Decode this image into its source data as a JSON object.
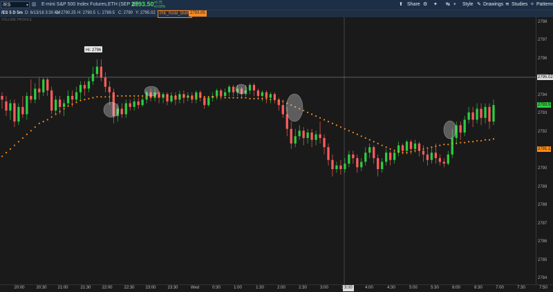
{
  "toolbar": {
    "symbol": "/ES",
    "description": "E-mini S&P 500 Index Futures,ETH (SEP 18)",
    "last_price": "2793.50",
    "change_top": "+0.75",
    "change_bottom": "+0.03%",
    "share_label": "Share",
    "style_label": "Style",
    "drawings_label": "Drawings",
    "studies_label": "Studies",
    "patterns_label": "Patterns"
  },
  "info": {
    "ticker": "/ES 5 D 5m",
    "date": "D: 6/13/18 3:30 AM",
    "open": "O: 2790.25",
    "high": "H: 2790.5",
    "low": "L: 2789.5",
    "close": "C: 2790",
    "y": "Y: 2795.02",
    "study_name": "PIK_RAM_5MIN",
    "study_value": "2793.05",
    "sub_label": "VOLUME PROFILE"
  },
  "annotations": {
    "hi_label": "Hi: 2796"
  },
  "price_tags": {
    "crosshair": "2795.02",
    "last": "2793.5",
    "ma": "2791.1"
  },
  "cursor_time": "3:30",
  "colors": {
    "up": "#2ecc40",
    "down": "#ff5c5c",
    "ma": "#ff8c1a",
    "bg": "#1a1a1a"
  },
  "yaxis": {
    "ticks": [
      "2798",
      "2797",
      "2796",
      "2795",
      "2794",
      "2793",
      "2792",
      "2791",
      "2790",
      "2789",
      "2788",
      "2787",
      "2786",
      "2785",
      "2784"
    ]
  },
  "xaxis": {
    "ticks": [
      "20:00",
      "20:30",
      "21:00",
      "21:30",
      "22:00",
      "22:30",
      "23:00",
      "23:30",
      "Wed",
      "0:30",
      "1:00",
      "1:30",
      "2:00",
      "2:30",
      "3:00",
      "3:30",
      "4:00",
      "4:30",
      "5:00",
      "5:30",
      "6:00",
      "6:30",
      "7:00",
      "7:30",
      "7:50"
    ]
  },
  "chart_data": {
    "type": "candlestick",
    "ylim": [
      2783.7,
      2798.3
    ],
    "candles": [
      [
        2794.0,
        2793.8,
        2794.2,
        2793.3
      ],
      [
        2793.7,
        2793.2,
        2794.0,
        2792.9
      ],
      [
        2793.2,
        2793.6,
        2793.8,
        2792.7
      ],
      [
        2793.6,
        2792.6,
        2793.8,
        2792.3
      ],
      [
        2792.6,
        2793.4,
        2793.6,
        2792.4
      ],
      [
        2793.4,
        2793.0,
        2794.0,
        2792.8
      ],
      [
        2793.0,
        2794.0,
        2794.2,
        2792.7
      ],
      [
        2794.0,
        2793.8,
        2794.9,
        2793.6
      ],
      [
        2793.8,
        2794.4,
        2794.7,
        2793.6
      ],
      [
        2794.4,
        2794.2,
        2795.0,
        2793.8
      ],
      [
        2794.2,
        2794.9,
        2795.0,
        2794.0
      ],
      [
        2794.9,
        2794.3,
        2795.0,
        2794.0
      ],
      [
        2794.3,
        2793.2,
        2794.5,
        2793.0
      ],
      [
        2793.2,
        2793.8,
        2794.0,
        2793.0
      ],
      [
        2793.8,
        2793.4,
        2794.0,
        2793.0
      ],
      [
        2793.4,
        2793.6,
        2793.8,
        2792.9
      ],
      [
        2793.6,
        2794.0,
        2794.3,
        2793.4
      ],
      [
        2794.0,
        2793.8,
        2794.3,
        2793.4
      ],
      [
        2793.8,
        2794.2,
        2794.5,
        2793.6
      ],
      [
        2794.2,
        2794.6,
        2794.8,
        2793.8
      ],
      [
        2794.6,
        2794.4,
        2794.8,
        2794.0
      ],
      [
        2794.4,
        2794.8,
        2795.0,
        2794.2
      ],
      [
        2794.8,
        2795.2,
        2795.6,
        2794.6
      ],
      [
        2795.2,
        2795.6,
        2796.0,
        2795.0
      ],
      [
        2795.6,
        2795.0,
        2796.0,
        2794.8
      ],
      [
        2795.0,
        2794.5,
        2795.3,
        2794.2
      ],
      [
        2794.5,
        2794.2,
        2794.8,
        2793.5
      ],
      [
        2794.2,
        2792.9,
        2794.4,
        2792.5
      ],
      [
        2792.9,
        2793.3,
        2793.6,
        2792.6
      ],
      [
        2793.3,
        2793.0,
        2793.6,
        2792.8
      ],
      [
        2793.0,
        2793.6,
        2793.8,
        2792.8
      ],
      [
        2793.6,
        2793.4,
        2793.8,
        2793.2
      ],
      [
        2793.4,
        2793.7,
        2793.9,
        2793.2
      ],
      [
        2793.7,
        2793.5,
        2793.9,
        2793.3
      ],
      [
        2793.5,
        2793.8,
        2794.0,
        2793.4
      ],
      [
        2793.8,
        2794.2,
        2794.3,
        2793.6
      ],
      [
        2794.2,
        2793.9,
        2794.4,
        2793.7
      ],
      [
        2793.9,
        2794.2,
        2794.4,
        2793.7
      ],
      [
        2794.2,
        2793.9,
        2794.3,
        2793.6
      ],
      [
        2793.9,
        2794.1,
        2794.2,
        2793.6
      ],
      [
        2794.1,
        2793.7,
        2794.2,
        2793.5
      ],
      [
        2793.7,
        2794.0,
        2794.2,
        2793.6
      ],
      [
        2794.0,
        2793.8,
        2794.2,
        2793.5
      ],
      [
        2793.8,
        2794.1,
        2794.3,
        2793.6
      ],
      [
        2794.1,
        2793.9,
        2794.3,
        2793.6
      ],
      [
        2793.9,
        2794.0,
        2794.2,
        2793.7
      ],
      [
        2794.0,
        2793.8,
        2794.2,
        2793.6
      ],
      [
        2793.8,
        2794.2,
        2794.3,
        2793.6
      ],
      [
        2794.2,
        2793.9,
        2794.3,
        2793.7
      ],
      [
        2793.9,
        2793.5,
        2794.0,
        2793.3
      ],
      [
        2793.5,
        2793.9,
        2794.0,
        2793.4
      ],
      [
        2793.9,
        2794.0,
        2794.2,
        2793.7
      ],
      [
        2794.0,
        2794.3,
        2794.4,
        2793.8
      ],
      [
        2794.3,
        2794.0,
        2794.4,
        2793.8
      ],
      [
        2794.0,
        2794.2,
        2794.4,
        2793.9
      ],
      [
        2794.2,
        2794.5,
        2794.6,
        2794.0
      ],
      [
        2794.5,
        2794.2,
        2794.6,
        2794.0
      ],
      [
        2794.2,
        2794.4,
        2794.6,
        2794.0
      ],
      [
        2794.4,
        2794.1,
        2794.5,
        2793.9
      ],
      [
        2794.1,
        2794.3,
        2794.6,
        2794.0
      ],
      [
        2794.3,
        2794.6,
        2794.7,
        2794.1
      ],
      [
        2794.6,
        2794.3,
        2794.7,
        2794.0
      ],
      [
        2794.3,
        2794.0,
        2794.4,
        2793.8
      ],
      [
        2794.0,
        2794.2,
        2794.3,
        2793.7
      ],
      [
        2794.2,
        2793.9,
        2794.3,
        2793.6
      ],
      [
        2793.9,
        2794.1,
        2794.2,
        2793.6
      ],
      [
        2794.1,
        2793.8,
        2794.2,
        2793.6
      ],
      [
        2793.8,
        2793.5,
        2793.9,
        2793.2
      ],
      [
        2793.5,
        2793.0,
        2793.8,
        2792.8
      ],
      [
        2793.0,
        2792.2,
        2793.4,
        2791.8
      ],
      [
        2792.2,
        2791.4,
        2792.6,
        2791.1
      ],
      [
        2791.4,
        2791.8,
        2792.2,
        2791.2
      ],
      [
        2791.8,
        2792.1,
        2792.4,
        2791.6
      ],
      [
        2792.1,
        2791.7,
        2792.3,
        2791.3
      ],
      [
        2791.7,
        2792.0,
        2792.2,
        2791.4
      ],
      [
        2792.0,
        2791.6,
        2792.2,
        2791.2
      ],
      [
        2791.6,
        2791.9,
        2792.1,
        2791.3
      ],
      [
        2791.9,
        2791.7,
        2792.6,
        2791.4
      ],
      [
        2791.7,
        2791.2,
        2791.9,
        2790.8
      ],
      [
        2791.2,
        2790.5,
        2791.4,
        2790.2
      ],
      [
        2790.5,
        2790.0,
        2790.8,
        2789.6
      ],
      [
        2790.0,
        2790.2,
        2790.4,
        2789.8
      ],
      [
        2790.2,
        2790.0,
        2790.5,
        2789.7
      ],
      [
        2790.0,
        2790.3,
        2790.6,
        2789.8
      ],
      [
        2790.3,
        2790.8,
        2791.0,
        2790.1
      ],
      [
        2790.8,
        2790.6,
        2791.0,
        2790.3
      ],
      [
        2790.6,
        2790.1,
        2790.8,
        2789.8
      ],
      [
        2790.1,
        2790.4,
        2790.6,
        2789.9
      ],
      [
        2790.4,
        2790.9,
        2791.2,
        2790.2
      ],
      [
        2790.9,
        2791.2,
        2791.4,
        2790.6
      ],
      [
        2791.2,
        2790.6,
        2791.3,
        2790.3
      ],
      [
        2790.6,
        2790.0,
        2790.8,
        2789.6
      ],
      [
        2790.0,
        2790.4,
        2790.6,
        2789.8
      ],
      [
        2790.4,
        2790.9,
        2791.1,
        2790.2
      ],
      [
        2790.9,
        2790.5,
        2791.0,
        2790.2
      ],
      [
        2790.5,
        2790.9,
        2791.1,
        2790.3
      ],
      [
        2790.9,
        2791.3,
        2791.5,
        2790.7
      ],
      [
        2791.3,
        2791.0,
        2791.4,
        2790.8
      ],
      [
        2791.0,
        2791.5,
        2791.6,
        2790.8
      ],
      [
        2791.5,
        2791.1,
        2791.6,
        2790.8
      ],
      [
        2791.1,
        2791.4,
        2791.6,
        2790.9
      ],
      [
        2791.4,
        2791.0,
        2791.5,
        2790.7
      ],
      [
        2791.0,
        2790.8,
        2791.3,
        2790.4
      ],
      [
        2790.8,
        2790.5,
        2791.1,
        2790.2
      ],
      [
        2790.5,
        2790.9,
        2791.2,
        2790.3
      ],
      [
        2790.9,
        2790.6,
        2791.4,
        2790.3
      ],
      [
        2790.6,
        2790.4,
        2790.8,
        2790.2
      ],
      [
        2790.4,
        2790.3,
        2790.6,
        2790.1
      ],
      [
        2790.3,
        2790.8,
        2791.0,
        2790.2
      ],
      [
        2790.8,
        2791.7,
        2792.2,
        2790.6
      ],
      [
        2791.7,
        2792.4,
        2792.6,
        2791.4
      ],
      [
        2792.4,
        2792.0,
        2792.6,
        2791.6
      ],
      [
        2792.0,
        2792.7,
        2792.9,
        2791.8
      ],
      [
        2792.7,
        2793.1,
        2793.4,
        2792.5
      ],
      [
        2793.1,
        2792.7,
        2793.4,
        2792.3
      ],
      [
        2792.7,
        2793.3,
        2793.6,
        2792.5
      ],
      [
        2793.3,
        2792.8,
        2793.6,
        2792.4
      ],
      [
        2792.8,
        2793.4,
        2793.6,
        2792.5
      ],
      [
        2793.4,
        2792.6,
        2793.6,
        2792.2
      ],
      [
        2792.6,
        2793.5,
        2793.8,
        2792.4
      ]
    ],
    "ma": [
      2790.7,
      2790.9,
      2791.1,
      2791.3,
      2791.5,
      2791.7,
      2791.9,
      2792.1,
      2792.3,
      2792.5,
      2792.6,
      2792.7,
      2792.85,
      2793.0,
      2793.15,
      2793.3,
      2793.45,
      2793.55,
      2793.65,
      2793.75,
      2793.8,
      2793.85,
      2793.9,
      2793.95,
      2793.95,
      2793.95,
      2793.95,
      2794.0,
      2794.0,
      2794.0,
      2794.0,
      2794.0,
      2794.0,
      2794.0,
      2794.0,
      2794.0,
      2794.0,
      2794.0,
      2794.0,
      2794.0,
      2794.0,
      2794.0,
      2794.0,
      2794.0,
      2794.0,
      2794.0,
      2794.0,
      2794.0,
      2793.95,
      2793.95,
      2793.95,
      2793.95,
      2793.95,
      2793.95,
      2793.9,
      2793.9,
      2793.9,
      2793.9,
      2793.9,
      2793.9,
      2793.85,
      2793.85,
      2793.85,
      2793.85,
      2793.85,
      2793.8,
      2793.8,
      2793.75,
      2793.7,
      2793.6,
      2793.5,
      2793.4,
      2793.3,
      2793.2,
      2793.1,
      2793.0,
      2792.9,
      2792.8,
      2792.7,
      2792.6,
      2792.5,
      2792.4,
      2792.3,
      2792.2,
      2792.1,
      2792.0,
      2791.9,
      2791.8,
      2791.7,
      2791.6,
      2791.5,
      2791.4,
      2791.3,
      2791.2,
      2791.1,
      2791.0,
      2790.95,
      2790.9,
      2790.9,
      2790.95,
      2791.0,
      2791.05,
      2791.1,
      2791.15,
      2791.2,
      2791.25,
      2791.3,
      2791.35,
      2791.35,
      2791.4,
      2791.4,
      2791.45,
      2791.45,
      2791.5,
      2791.5,
      2791.55,
      2791.55,
      2791.6,
      2791.6,
      2791.65
    ]
  }
}
